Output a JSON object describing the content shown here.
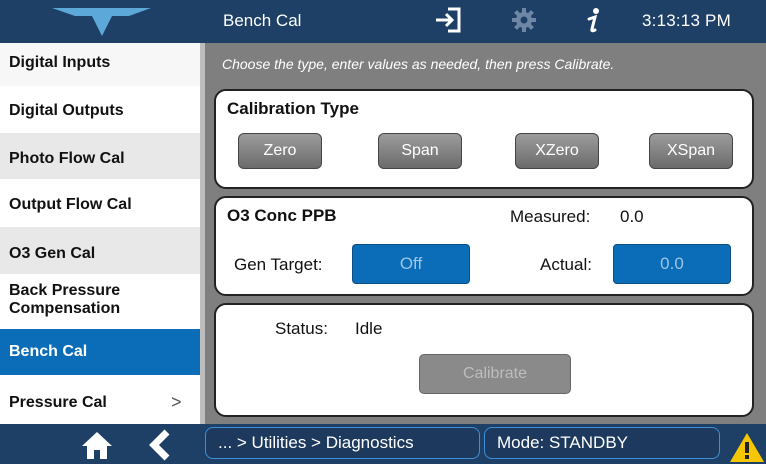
{
  "header": {
    "title": "Bench Cal",
    "time": "3:13:13 PM",
    "icons": [
      "logo-icon",
      "logout-icon",
      "gear-icon",
      "info-icon"
    ]
  },
  "sidebar": {
    "items": [
      {
        "label": "Digital Inputs"
      },
      {
        "label": "Digital Outputs"
      },
      {
        "label": "Photo Flow Cal"
      },
      {
        "label": "Output Flow Cal"
      },
      {
        "label": "O3 Gen Cal"
      },
      {
        "label": "Back Pressure Compensation"
      },
      {
        "label": "Bench Cal"
      },
      {
        "label": "Pressure Cal",
        "chevron": ">"
      }
    ],
    "active_item": "Bench Cal"
  },
  "main": {
    "instruction": "Choose the type, enter values as needed, then press Calibrate.",
    "calibration_type": {
      "title": "Calibration Type",
      "buttons": [
        "Zero",
        "Span",
        "XZero",
        "XSpan"
      ]
    },
    "conc": {
      "title": "O3 Conc PPB",
      "measured_label": "Measured:",
      "measured_value": "0.0",
      "gen_target_label": "Gen Target:",
      "gen_target_value": "Off",
      "actual_label": "Actual:",
      "actual_value": "0.0"
    },
    "status": {
      "label": "Status:",
      "value": "Idle",
      "calibrate_label": "Calibrate"
    }
  },
  "footer": {
    "breadcrumb": "... > Utilities > Diagnostics",
    "mode": "Mode: STANDBY",
    "icons": [
      "home-icon",
      "back-icon",
      "warning-icon"
    ]
  },
  "colors": {
    "header_bg": "#1e3f66",
    "accent_blue": "#0b6db8",
    "panel_bg": "#ffffff",
    "main_bg": "#7f7f7f",
    "warning": "#f6c700"
  }
}
